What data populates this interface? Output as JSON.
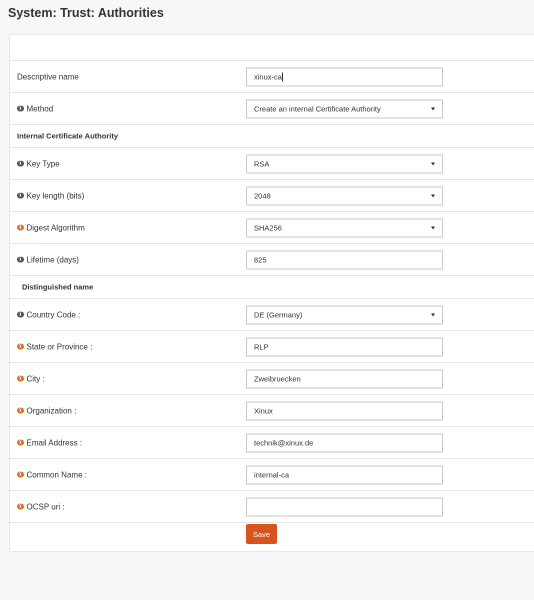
{
  "header": {
    "title": "System: Trust: Authorities"
  },
  "form": {
    "descriptive_name": {
      "label": "Descriptive name",
      "value": "xinux-ca"
    },
    "method": {
      "label": "Method",
      "value": "Create an internal Certificate Authority"
    },
    "section_internal": "Internal Certificate Authority",
    "key_type": {
      "label": "Key Type",
      "value": "RSA"
    },
    "key_length": {
      "label": "Key length (bits)",
      "value": "2048"
    },
    "digest": {
      "label": "Digest Algorithm",
      "value": "SHA256"
    },
    "lifetime": {
      "label": "Lifetime (days)",
      "value": "825"
    },
    "section_dn": "Distinguished name",
    "country": {
      "label": "Country Code :",
      "value": "DE (Germany)"
    },
    "state": {
      "label": "State or Province :",
      "value": "RLP"
    },
    "city": {
      "label": "City :",
      "value": "Zweibruecken"
    },
    "org": {
      "label": "Organization :",
      "value": "Xinux"
    },
    "email": {
      "label": "Email Address :",
      "value": "technik@xinux.de"
    },
    "common_name": {
      "label": "Common Name :",
      "value": "internal-ca"
    },
    "ocsp": {
      "label": "OCSP uri :",
      "value": ""
    },
    "save_label": "Save"
  },
  "colors": {
    "accent": "#d9531e",
    "info_orange": "#d9722e",
    "info_gray": "#555555"
  }
}
